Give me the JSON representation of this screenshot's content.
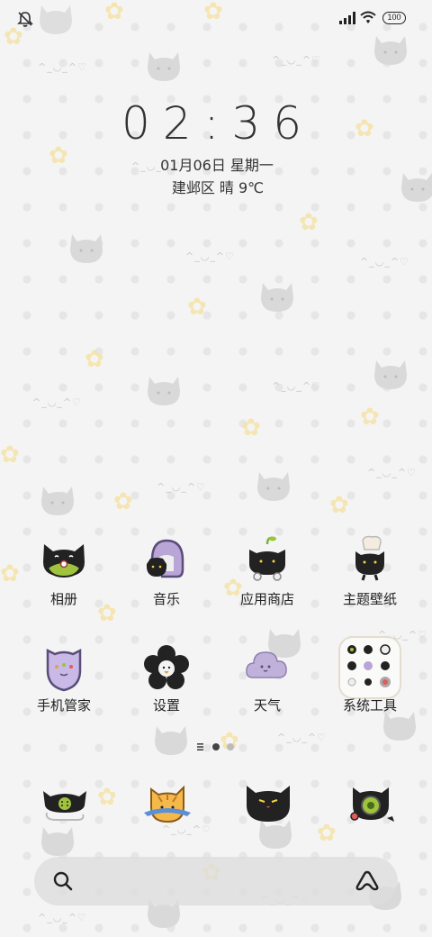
{
  "status_bar": {
    "silent_icon": "bell-off-icon",
    "signal_icon": "signal-icon",
    "wifi_icon": "wifi-icon",
    "battery_level": "100"
  },
  "clock": {
    "time": "02:36",
    "date": "01月06日 星期一",
    "weather": "建邺区 晴 9℃"
  },
  "apps": [
    {
      "label": "相册",
      "icon": "album-cat-icon"
    },
    {
      "label": "音乐",
      "icon": "music-cat-icon"
    },
    {
      "label": "应用商店",
      "icon": "app-store-cat-icon"
    },
    {
      "label": "主题壁纸",
      "icon": "theme-wallpaper-cat-icon"
    },
    {
      "label": "手机管家",
      "icon": "phone-manager-cat-icon"
    },
    {
      "label": "设置",
      "icon": "settings-flower-icon"
    },
    {
      "label": "天气",
      "icon": "weather-cloud-icon"
    },
    {
      "label": "系统工具",
      "icon": "system-tools-folder-icon"
    }
  ],
  "pager": {
    "pages": 2,
    "active_page": 1
  },
  "dock": [
    {
      "icon": "phone-cat-icon"
    },
    {
      "icon": "browser-cat-icon"
    },
    {
      "icon": "messages-cat-icon"
    },
    {
      "icon": "camera-cat-icon"
    }
  ],
  "search": {
    "search_icon": "search-icon",
    "assistant_icon": "assistant-icon"
  },
  "colors": {
    "background": "#f4f4f4",
    "text": "#222222",
    "pager_active": "#444444",
    "pager_inactive": "#bbbbbb",
    "search_bar": "#dcdcdc"
  }
}
